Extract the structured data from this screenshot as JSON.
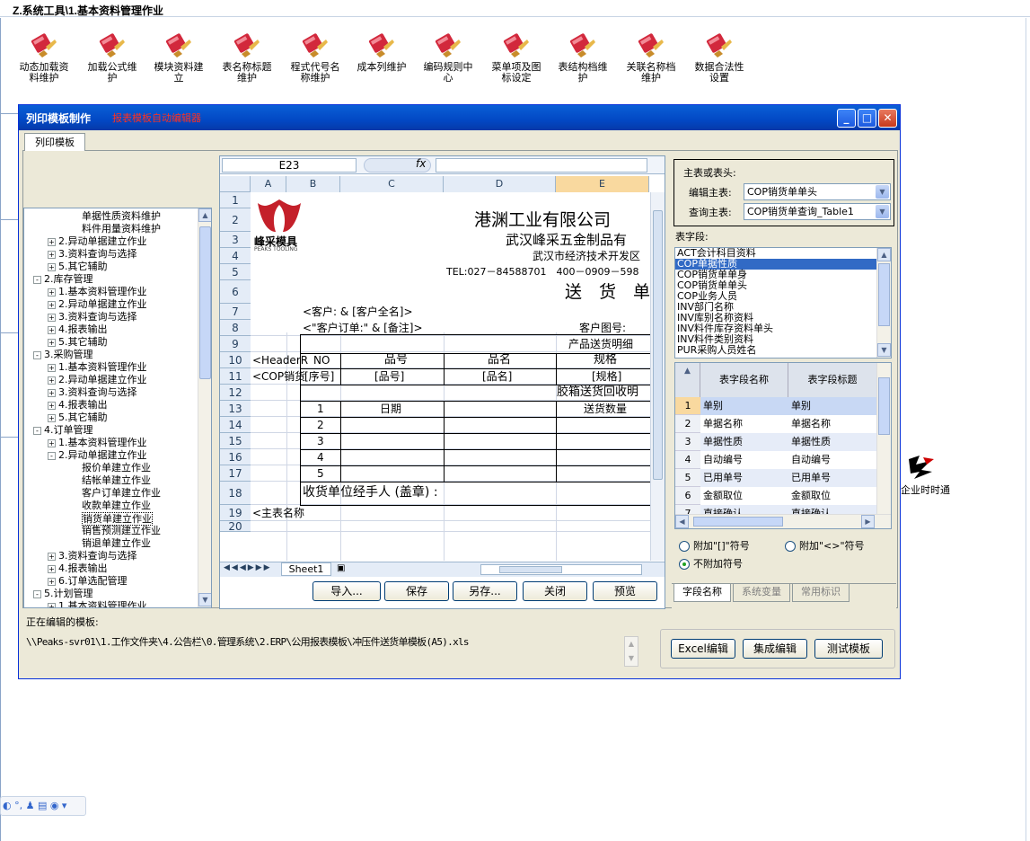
{
  "breadcrumb": "Z.系统工具\\1.基本资料管理作业",
  "toolbar": [
    {
      "l1": "动态加载资",
      "l2": "料维护"
    },
    {
      "l1": "加载公式维",
      "l2": "护"
    },
    {
      "l1": "模块资料建",
      "l2": "立"
    },
    {
      "l1": "表名称标题",
      "l2": "维护"
    },
    {
      "l1": "程式代号名",
      "l2": "称维护"
    },
    {
      "l1": "成本列维护",
      "l2": ""
    },
    {
      "l1": "编码规则中",
      "l2": "心"
    },
    {
      "l1": "菜单项及图",
      "l2": "标设定"
    },
    {
      "l1": "表结构档维",
      "l2": "护"
    },
    {
      "l1": "关联名称档",
      "l2": "维护"
    },
    {
      "l1": "数据合法性",
      "l2": "设置"
    }
  ],
  "bg_right": {
    "text": "企业时时通",
    "icon": "logo-icon"
  },
  "window": {
    "title": "列印模板制作",
    "subtitle": "报表模板自动编辑器",
    "tab": "列印模板",
    "min": "_",
    "max": "□",
    "close": "✕"
  },
  "tree": [
    {
      "t": "单据性质资料维护",
      "lv": 3,
      "pm": ""
    },
    {
      "t": "料件用量资料维护",
      "lv": 3,
      "pm": ""
    },
    {
      "t": "2.异动单据建立作业",
      "lv": 1,
      "pm": "+"
    },
    {
      "t": "3.资料查询与选择",
      "lv": 1,
      "pm": "+"
    },
    {
      "t": "5.其它辅助",
      "lv": 1,
      "pm": "+"
    },
    {
      "t": "2.库存管理",
      "lv": 0,
      "pm": "-"
    },
    {
      "t": "1.基本资料管理作业",
      "lv": 1,
      "pm": "+"
    },
    {
      "t": "2.异动单据建立作业",
      "lv": 1,
      "pm": "+"
    },
    {
      "t": "3.资料查询与选择",
      "lv": 1,
      "pm": "+"
    },
    {
      "t": "4.报表输出",
      "lv": 1,
      "pm": "+"
    },
    {
      "t": "5.其它辅助",
      "lv": 1,
      "pm": "+"
    },
    {
      "t": "3.采购管理",
      "lv": 0,
      "pm": "-"
    },
    {
      "t": "1.基本资料管理作业",
      "lv": 1,
      "pm": "+"
    },
    {
      "t": "2.异动单据建立作业",
      "lv": 1,
      "pm": "+"
    },
    {
      "t": "3.资料查询与选择",
      "lv": 1,
      "pm": "+"
    },
    {
      "t": "4.报表输出",
      "lv": 1,
      "pm": "+"
    },
    {
      "t": "5.其它辅助",
      "lv": 1,
      "pm": "+"
    },
    {
      "t": "4.订单管理",
      "lv": 0,
      "pm": "-"
    },
    {
      "t": "1.基本资料管理作业",
      "lv": 1,
      "pm": "+"
    },
    {
      "t": "2.异动单据建立作业",
      "lv": 1,
      "pm": "-"
    },
    {
      "t": "报价单建立作业",
      "lv": 3,
      "pm": ""
    },
    {
      "t": "结帐单建立作业",
      "lv": 3,
      "pm": ""
    },
    {
      "t": "客户订单建立作业",
      "lv": 3,
      "pm": ""
    },
    {
      "t": "收款单建立作业",
      "lv": 3,
      "pm": ""
    },
    {
      "t": "销货单建立作业",
      "lv": 3,
      "pm": "",
      "sel": true
    },
    {
      "t": "销售预测建立作业",
      "lv": 3,
      "pm": ""
    },
    {
      "t": "销退单建立作业",
      "lv": 3,
      "pm": ""
    },
    {
      "t": "3.资料查询与选择",
      "lv": 1,
      "pm": "+"
    },
    {
      "t": "4.报表输出",
      "lv": 1,
      "pm": "+"
    },
    {
      "t": "6.订单选配管理",
      "lv": 1,
      "pm": "+"
    },
    {
      "t": "5.计划管理",
      "lv": 0,
      "pm": "-"
    },
    {
      "t": "1.基本资料管理作业",
      "lv": 1,
      "pm": "+"
    }
  ],
  "excel": {
    "namebox": "E23",
    "fx": "fx",
    "cols": [
      "A",
      "B",
      "C",
      "D",
      "E"
    ],
    "rows": [
      "1",
      "2",
      "3",
      "4",
      "5",
      "6",
      "7",
      "8",
      "9",
      "10",
      "11",
      "12",
      "13",
      "14",
      "15",
      "16",
      "17",
      "18",
      "19",
      "20"
    ],
    "company": "港渊工业有限公司",
    "company2": "武汉峰采五金制品有",
    "address": "武汉市经济技术开发区",
    "tel": "TEL:027－84588701　400－0909－598",
    "doctitle": "送　货　单",
    "logo_name": "峰采模具",
    "logo_en": "PEAKS TOOLING",
    "customer": "<客户: & [客户全名]>",
    "order": "<\"客户订单:\" & [备注]>",
    "custfig": "客户图号:",
    "detail_title": "产品送货明细",
    "header_ref": "<HeaderR",
    "cop_ref": "<COP销货",
    "hdr_no": "NO",
    "hdr_pn": "品号",
    "hdr_name": "品名",
    "hdr_spec": "规格",
    "f_no": "[序号]",
    "f_pn": "[品号]",
    "f_name": "[品名]",
    "f_spec": "[规格]",
    "box_title": "胶箱送货回收明",
    "date": "日期",
    "qty": "送货数量",
    "nums": [
      "1",
      "2",
      "3",
      "4",
      "5"
    ],
    "receiver": "收货单位经手人 (盖章) :",
    "main_name": "<主表名称",
    "sheet": "Sheet1"
  },
  "buttons": {
    "import": "导入...",
    "save": "保存",
    "saveas": "另存...",
    "close": "关闭",
    "preview": "预览"
  },
  "right": {
    "group": "主表或表头:",
    "edit_label": "编辑主表:",
    "edit_val": "COP销货单单头",
    "query_label": "查询主表:",
    "query_val": "COP销货单查询_Table1",
    "fields_label": "表字段:",
    "tables": [
      "ACT会计科目资料",
      "COP单据性质",
      "COP销货单单身",
      "COP销货单单头",
      "COP业务人员",
      "INV部门名称",
      "INV库别名称资料",
      "INV料件库存资料单头",
      "INV料件类别资料",
      "PUR采购人员姓名"
    ],
    "grid_h1": "表字段名称",
    "grid_h2": "表字段标题",
    "grid": [
      {
        "n": "1",
        "a": "单别",
        "b": "单别"
      },
      {
        "n": "2",
        "a": "单据名称",
        "b": "单据名称"
      },
      {
        "n": "3",
        "a": "单据性质",
        "b": "单据性质"
      },
      {
        "n": "4",
        "a": "自动编号",
        "b": "自动编号"
      },
      {
        "n": "5",
        "a": "已用单号",
        "b": "已用单号"
      },
      {
        "n": "6",
        "a": "金额取位",
        "b": "金额取位"
      },
      {
        "n": "7",
        "a": "直接确认",
        "b": "直接确认"
      }
    ],
    "r1": "附加\"[]\"符号",
    "r2": "附加\"<>\"符号",
    "r3": "不附加符号",
    "tabs": [
      "字段名称",
      "系统变量",
      "常用标识"
    ]
  },
  "editing_label": "正在编辑的模板:",
  "path": "\\\\Peaks-svr01\\1.工作文件夹\\4.公告栏\\0.管理系统\\2.ERP\\公用报表模板\\冲压件送货单模板(A5).xls",
  "bottom_buttons": {
    "excel": "Excel编辑",
    "integrated": "集成编辑",
    "test": "测试模板"
  },
  "colors": {
    "title_bar": "#0248c4",
    "subtitle": "#ff3020",
    "selected": "#316ac5"
  }
}
